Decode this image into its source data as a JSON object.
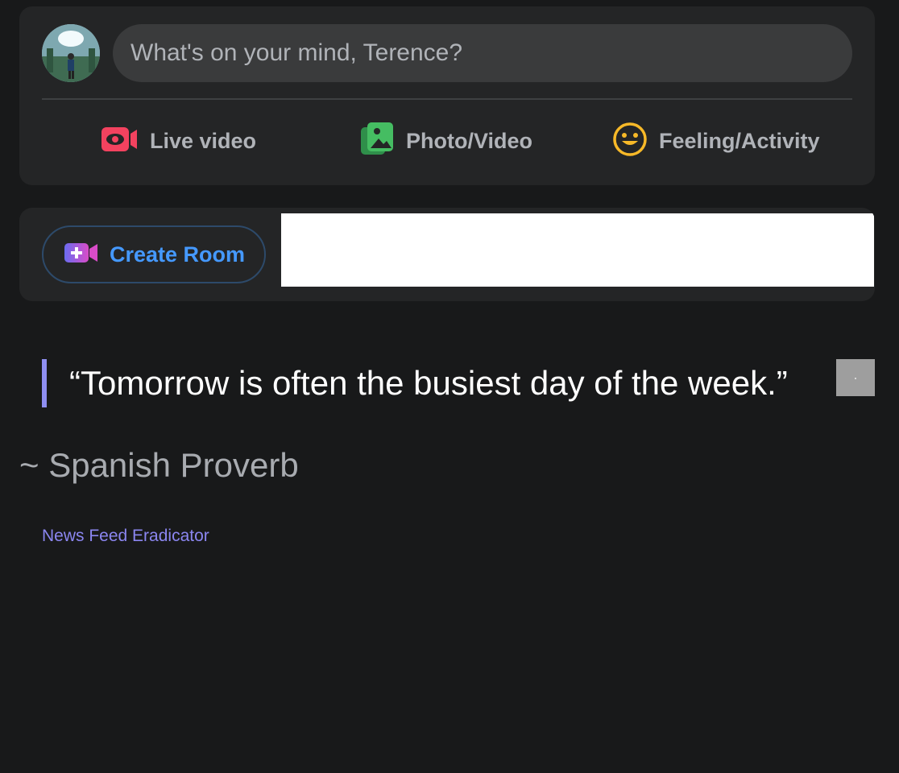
{
  "composer": {
    "placeholder": "What's on your mind, Terence?",
    "avatar_icon": "user-avatar",
    "actions": [
      {
        "label": "Live video",
        "icon": "live-video-icon",
        "color": "#f3425f"
      },
      {
        "label": "Photo/Video",
        "icon": "photo-icon",
        "color": "#45bd62"
      },
      {
        "label": "Feeling/Activity",
        "icon": "smiley-icon",
        "color": "#f7b928"
      }
    ]
  },
  "rooms": {
    "create_label": "Create Room",
    "icon": "create-room-icon",
    "accent": "#4599ff"
  },
  "quote": {
    "text": "“Tomorrow is often the busiest day of the week.”",
    "author": "~ Spanish Proverb",
    "bar_color": "#8f8ff2"
  },
  "footer": {
    "link": "News Feed Eradicator",
    "link_color": "#8b86f0"
  },
  "theme": {
    "background": "#18191a",
    "card": "#242526",
    "input": "#3a3b3c"
  }
}
